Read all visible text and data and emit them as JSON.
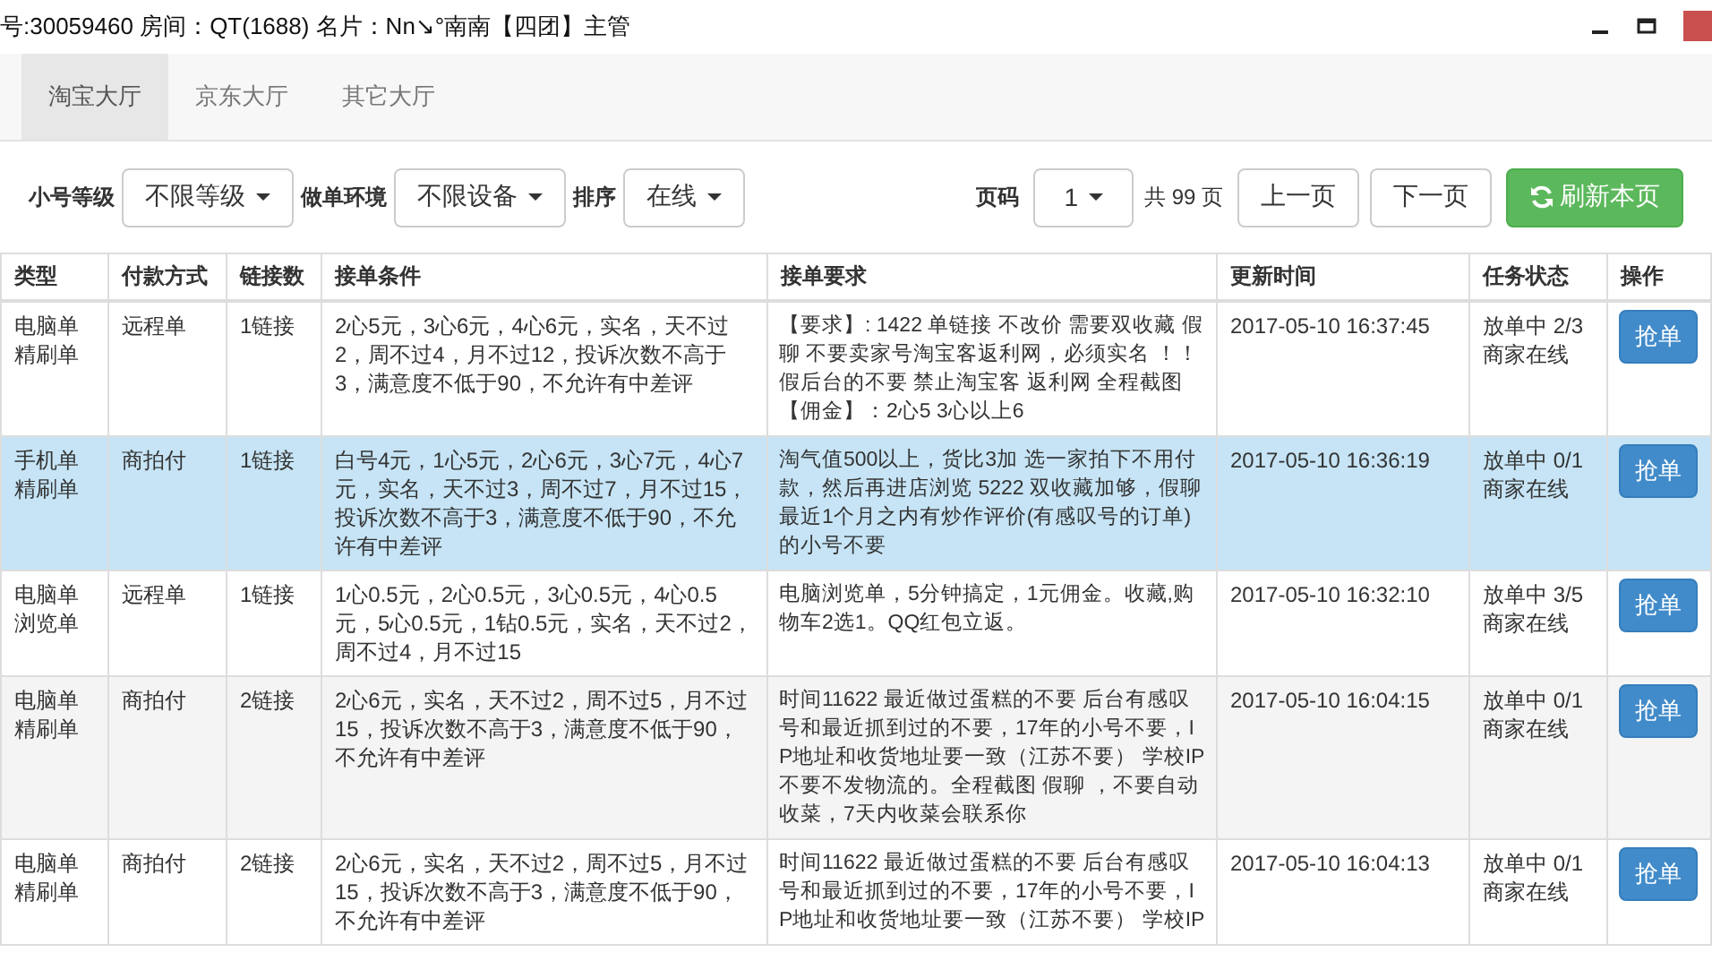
{
  "window": {
    "title": "号:30059460 房间：QT(1688) 名片：Nn↘°南南【四团】主管"
  },
  "tabs": [
    {
      "label": "淘宝大厅",
      "selected": true
    },
    {
      "label": "京东大厅",
      "selected": false
    },
    {
      "label": "其它大厅",
      "selected": false
    }
  ],
  "filters": [
    {
      "label": "小号等级",
      "value": "不限等级"
    },
    {
      "label": "做单环境",
      "value": "不限设备"
    },
    {
      "label": "排序",
      "value": "在线"
    }
  ],
  "pagination": {
    "label": "页码",
    "page": "1",
    "total": "共 99 页",
    "prev": "上一页",
    "next": "下一页",
    "refresh": "刷新本页"
  },
  "table": {
    "columns": [
      "类型",
      "付款方式",
      "链接数",
      "接单条件",
      "接单要求",
      "更新时间",
      "任务状态",
      "操作"
    ],
    "rows": [
      {
        "selected": false,
        "type": "电脑单精刷单",
        "payment": "远程单",
        "links": "1链接",
        "conditions": "2心5元，3心6元，4心6元，实名，天不过2，周不过4，月不过12，投诉次数不高于3，满意度不低于90，不允许有中差评",
        "requirements": "【要求】: 1422 单链接 不改价 需要双收藏 假聊 不要卖家号淘宝客返利网，必须实名 ！！假后台的不要 禁止淘宝客 返利网 全程截图【佣金】：2心5 3心以上6",
        "time": "2017-05-10 16:37:45",
        "status": "放单中 2/3",
        "merchant": "商家在线",
        "action": "抢单"
      },
      {
        "selected": true,
        "type": "手机单精刷单",
        "payment": "商拍付",
        "links": "1链接",
        "conditions": "白号4元，1心5元，2心6元，3心7元，4心7元，实名，天不过3，周不过7，月不过15，投诉次数不高于3，满意度不低于90，不允许有中差评",
        "requirements": "淘气值500以上，货比3加 选一家拍下不用付款，然后再进店浏览 5222 双收藏加够，假聊最近1个月之内有炒作评价(有感叹号的订单)的小号不要",
        "time": "2017-05-10 16:36:19",
        "status": "放单中 0/1",
        "merchant": "商家在线",
        "action": "抢单"
      },
      {
        "selected": false,
        "type": "电脑单浏览单",
        "payment": "远程单",
        "links": "1链接",
        "conditions": "1心0.5元，2心0.5元，3心0.5元，4心0.5元，5心0.5元，1钻0.5元，实名，天不过2，周不过4，月不过15",
        "requirements": "电脑浏览单，5分钟搞定，1元佣金。收藏,购物车2选1。QQ红包立返。",
        "time": "2017-05-10 16:32:10",
        "status": "放单中 3/5",
        "merchant": "商家在线",
        "action": "抢单"
      },
      {
        "selected": false,
        "type": "电脑单精刷单",
        "payment": "商拍付",
        "links": "2链接",
        "conditions": "2心6元，实名，天不过2，周不过5，月不过15，投诉次数不高于3，满意度不低于90，不允许有中差评",
        "requirements": "时间11622 最近做过蛋糕的不要 后台有感叹号和最近抓到过的不要，17年的小号不要，IP地址和收货地址要一致（江苏不要） 学校IP不要不发物流的。全程截图 假聊 ，不要自动收菜，7天内收菜会联系你",
        "time": "2017-05-10 16:04:15",
        "status": "放单中 0/1",
        "merchant": "商家在线",
        "action": "抢单"
      },
      {
        "selected": false,
        "type": "电脑单精刷单",
        "payment": "商拍付",
        "links": "2链接",
        "conditions": "2心6元，实名，天不过2，周不过5，月不过15，投诉次数不高于3，满意度不低于90，不允许有中差评",
        "requirements": "时间11622 最近做过蛋糕的不要 后台有感叹号和最近抓到过的不要，17年的小号不要，IP地址和收货地址要一致（江苏不要） 学校IP",
        "time": "2017-05-10 16:04:13",
        "status": "放单中 0/1",
        "merchant": "商家在线",
        "action": "抢单"
      }
    ]
  }
}
